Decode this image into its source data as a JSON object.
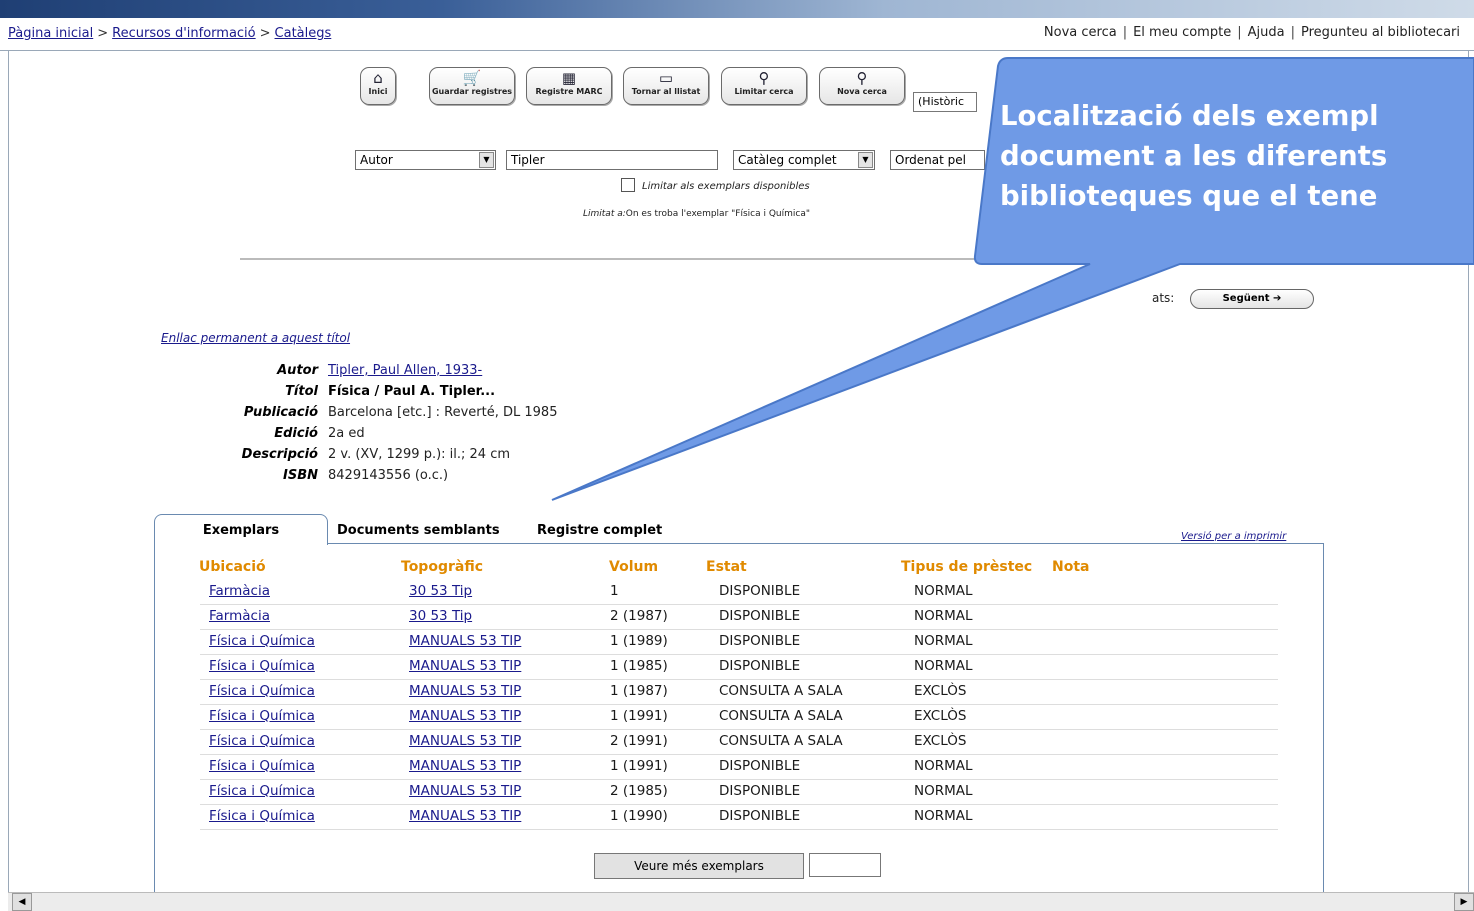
{
  "nav": {
    "breadcrumb": [
      "Pàgina inicial",
      "Recursos d'informació",
      "Catàlegs"
    ],
    "top_links": [
      "Nova cerca",
      "El meu compte",
      "Ajuda",
      "Pregunteu al bibliotecari"
    ]
  },
  "toolbar": {
    "buttons": [
      {
        "label": "Inici",
        "icon": "home-icon"
      },
      {
        "label": "Guardar registres",
        "icon": "cart-icon"
      },
      {
        "label": "Registre MARC",
        "icon": "marc-icon"
      },
      {
        "label": "Tornar al llistat",
        "icon": "list-icon"
      },
      {
        "label": "Limitar cerca",
        "icon": "search-limit-icon"
      },
      {
        "label": "Nova cerca",
        "icon": "search-icon"
      }
    ],
    "history_select": "(Històric"
  },
  "search": {
    "field": "Autor",
    "query": "Tipler",
    "scope": "Catàleg complet",
    "sort": "Ordenat pel",
    "checkbox_label": "Limitar als exemplars disponibles",
    "limit_prefix": "Limitat a:",
    "limit_text": "On es troba l'exemplar \"Física i Química\""
  },
  "results_nav": {
    "label": "ats:",
    "next_label": "Següent ➔"
  },
  "record": {
    "permalink": "Enllac permanent a aquest títol",
    "fields": [
      {
        "label": "Autor",
        "value": "Tipler, Paul Allen, 1933-",
        "link": true,
        "bold": false
      },
      {
        "label": "Títol",
        "value": "Física / Paul A. Tipler...",
        "link": false,
        "bold": true
      },
      {
        "label": "Publicació",
        "value": "Barcelona [etc.] : Reverté, DL 1985",
        "link": false,
        "bold": false
      },
      {
        "label": "Edició",
        "value": "2a ed",
        "link": false,
        "bold": false
      },
      {
        "label": "Descripció",
        "value": "2 v. (XV, 1299 p.): il.; 24 cm",
        "link": false,
        "bold": false
      },
      {
        "label": "ISBN",
        "value": "8429143556 (o.c.)",
        "link": false,
        "bold": false
      }
    ]
  },
  "tabs": {
    "active": "Exemplars",
    "others": [
      "Documents semblants",
      "Registre complet"
    ],
    "print": "Versió per a imprimir"
  },
  "holdings": {
    "headers": [
      "Ubicació",
      "Topogràfic",
      "Volum",
      "Estat",
      "Tipus de prèstec",
      "Nota"
    ],
    "rows": [
      [
        "Farmàcia",
        "30 53 Tip",
        "1",
        "DISPONIBLE",
        "NORMAL"
      ],
      [
        "Farmàcia",
        "30 53 Tip",
        "2 (1987)",
        "DISPONIBLE",
        "NORMAL"
      ],
      [
        "Física i Química",
        "MANUALS 53 TIP",
        "1 (1989)",
        "DISPONIBLE",
        "NORMAL"
      ],
      [
        "Física i Química",
        "MANUALS 53 TIP",
        "1 (1985)",
        "DISPONIBLE",
        "NORMAL"
      ],
      [
        "Física i Química",
        "MANUALS 53 TIP",
        "1 (1987)",
        "CONSULTA A SALA",
        "EXCLÒS"
      ],
      [
        "Física i Química",
        "MANUALS 53 TIP",
        "1 (1991)",
        "CONSULTA A SALA",
        "EXCLÒS"
      ],
      [
        "Física i Química",
        "MANUALS 53 TIP",
        "2 (1991)",
        "CONSULTA A SALA",
        "EXCLÒS"
      ],
      [
        "Física i Química",
        "MANUALS 53 TIP",
        "1 (1991)",
        "DISPONIBLE",
        "NORMAL"
      ],
      [
        "Física i Química",
        "MANUALS 53 TIP",
        "2 (1985)",
        "DISPONIBLE",
        "NORMAL"
      ],
      [
        "Física i Química",
        "MANUALS 53 TIP",
        "1 (1990)",
        "DISPONIBLE",
        "NORMAL"
      ]
    ],
    "more_button": "Veure més exemplars"
  },
  "callout": {
    "lines": [
      "Localització dels exempl",
      "document a les diferents",
      "biblioteques que el tene"
    ],
    "fill": "#6f9ae6",
    "stroke": "#4a78c8"
  },
  "colors": {
    "header": "#e08a00",
    "link": "#1a1a8c",
    "frame": "#6a8ab0"
  }
}
